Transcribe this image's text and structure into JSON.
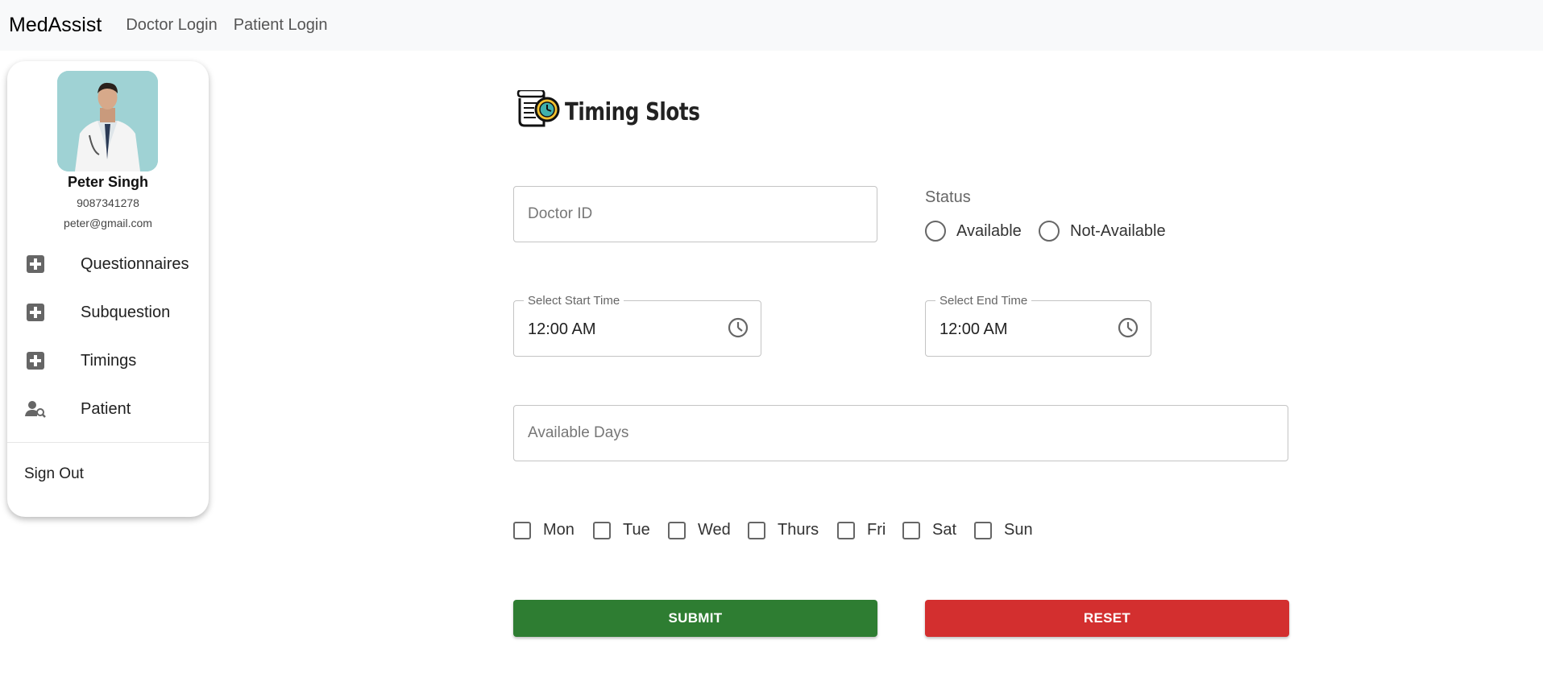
{
  "navbar": {
    "brand": "MedAssist",
    "links": [
      "Doctor Login",
      "Patient Login"
    ]
  },
  "sidebar": {
    "doctor_name": "Peter Singh",
    "phone": "9087341278",
    "email": "peter@gmail.com",
    "menu": [
      {
        "label": "Questionnaires",
        "icon": "plus-box-icon"
      },
      {
        "label": "Subquestion",
        "icon": "plus-box-icon"
      },
      {
        "label": "Timings",
        "icon": "plus-box-icon"
      },
      {
        "label": "Patient",
        "icon": "person-search-icon"
      }
    ],
    "sign_out": "Sign Out"
  },
  "form": {
    "title": "Timing Slots",
    "doctor_id_placeholder": "Doctor ID",
    "status_label": "Status",
    "status_options": [
      "Available",
      "Not-Available"
    ],
    "start_time_label": "Select Start Time",
    "start_time_value": "12:00 AM",
    "end_time_label": "Select End Time",
    "end_time_value": "12:00 AM",
    "available_days_placeholder": "Available Days",
    "days": [
      "Mon",
      "Tue",
      "Wed",
      "Thurs",
      "Fri",
      "Sat",
      "Sun"
    ],
    "submit_label": "SUBMIT",
    "reset_label": "RESET"
  },
  "colors": {
    "submit": "#2e7d32",
    "reset": "#d32f2f",
    "navbar_bg": "#f8f9fa"
  }
}
